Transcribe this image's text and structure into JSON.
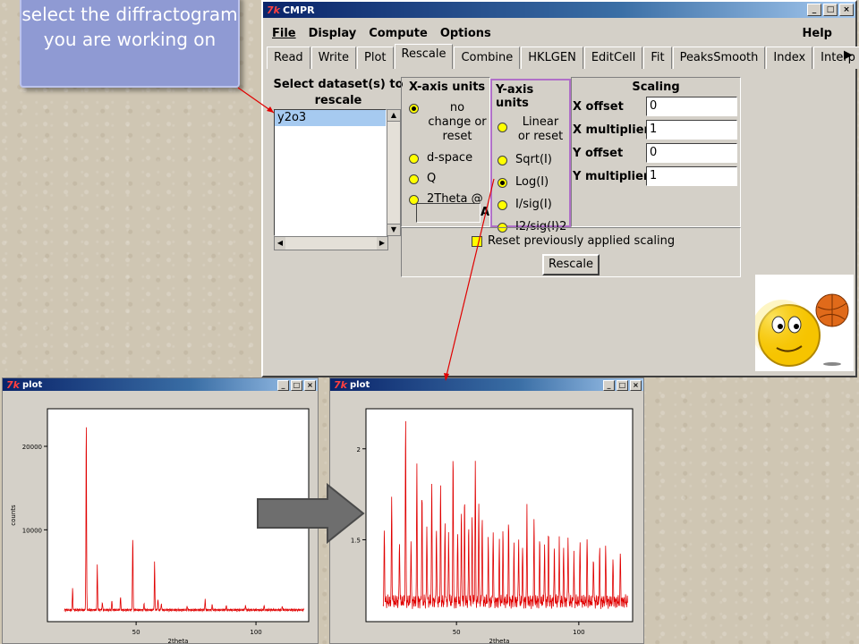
{
  "callout": {
    "text": "select the diffractogram you are working on"
  },
  "cmpr": {
    "title": "CMPR",
    "title_logo": "7k",
    "window_buttons": [
      "_",
      "□",
      "×"
    ],
    "menu": [
      "File",
      "Display",
      "Compute",
      "Options"
    ],
    "help": "Help",
    "tabs": [
      "Read",
      "Write",
      "Plot",
      "Rescale",
      "Combine",
      "HKLGEN",
      "EditCell",
      "Fit",
      "PeaksSmooth",
      "Index",
      "Interp"
    ],
    "active_tab": "Rescale",
    "dataset": {
      "header": "Select dataset(s) to rescale",
      "items": [
        "y2o3"
      ],
      "selected": "y2o3"
    },
    "xaxis": {
      "header": "X-axis units",
      "options": [
        "no change or reset",
        "d-space",
        "Q",
        "2Theta @"
      ],
      "selected": "no change or reset",
      "wavelength_value": "",
      "wavelength_unit": "A"
    },
    "yaxis": {
      "header": "Y-axis units",
      "options": [
        "Linear or reset",
        "Sqrt(I)",
        "Log(I)",
        "I/sig(I)",
        "I2/sig(I)2"
      ],
      "selected": "Log(I)"
    },
    "scaling": {
      "header": "Scaling",
      "rows": [
        {
          "label": "X offset",
          "value": "0"
        },
        {
          "label": "X multiplier",
          "value": "1"
        },
        {
          "label": "Y offset",
          "value": "0"
        },
        {
          "label": "Y multiplier",
          "value": "1"
        }
      ]
    },
    "reset_checkbox": {
      "label": "Reset previously applied scaling",
      "checked": false
    },
    "rescale_button": "Rescale"
  },
  "plot_left": {
    "title": "plot",
    "chart_data": {
      "type": "line",
      "xlabel": "2theta",
      "ylabel": "counts",
      "xlim": [
        13,
        122
      ],
      "ylim": [
        -1000,
        24500
      ],
      "xticks": [
        50,
        100
      ],
      "yticks": [
        10000,
        20000
      ],
      "series_color": "#e00000",
      "baseline": 400,
      "peaks": [
        {
          "x": 23.5,
          "y": 3000
        },
        {
          "x": 29.2,
          "y": 23300
        },
        {
          "x": 33.8,
          "y": 5700
        },
        {
          "x": 35.9,
          "y": 1300
        },
        {
          "x": 39.9,
          "y": 1500
        },
        {
          "x": 43.5,
          "y": 1900
        },
        {
          "x": 48.6,
          "y": 9300
        },
        {
          "x": 53.3,
          "y": 1100
        },
        {
          "x": 57.7,
          "y": 6200
        },
        {
          "x": 59.1,
          "y": 1700
        },
        {
          "x": 60.5,
          "y": 1200
        },
        {
          "x": 71.3,
          "y": 800
        },
        {
          "x": 78.8,
          "y": 1600
        },
        {
          "x": 81.7,
          "y": 1000
        },
        {
          "x": 87.6,
          "y": 900
        },
        {
          "x": 95.6,
          "y": 1000
        },
        {
          "x": 103.4,
          "y": 900
        },
        {
          "x": 111.0,
          "y": 800
        }
      ]
    }
  },
  "plot_right": {
    "title": "plot",
    "chart_data": {
      "type": "line",
      "xlabel": "2theta",
      "ylabel": "",
      "xlim": [
        13,
        122
      ],
      "ylim": [
        1.05,
        2.22
      ],
      "xticks": [
        50,
        100
      ],
      "yticks": [
        1.5,
        2
      ],
      "series_color": "#e00000",
      "baseline": 1.16,
      "peaks": [
        {
          "x": 20.5,
          "y": 1.55
        },
        {
          "x": 23.5,
          "y": 1.73
        },
        {
          "x": 26.7,
          "y": 1.52
        },
        {
          "x": 29.2,
          "y": 2.18
        },
        {
          "x": 31.4,
          "y": 1.5
        },
        {
          "x": 33.8,
          "y": 1.88
        },
        {
          "x": 35.9,
          "y": 1.78
        },
        {
          "x": 37.9,
          "y": 1.6
        },
        {
          "x": 39.9,
          "y": 1.82
        },
        {
          "x": 41.8,
          "y": 1.58
        },
        {
          "x": 43.5,
          "y": 1.8
        },
        {
          "x": 45.3,
          "y": 1.6
        },
        {
          "x": 46.8,
          "y": 1.55
        },
        {
          "x": 48.6,
          "y": 2.0
        },
        {
          "x": 50.5,
          "y": 1.55
        },
        {
          "x": 52.0,
          "y": 1.66
        },
        {
          "x": 53.3,
          "y": 1.72
        },
        {
          "x": 55.0,
          "y": 1.58
        },
        {
          "x": 56.4,
          "y": 1.62
        },
        {
          "x": 57.7,
          "y": 1.92
        },
        {
          "x": 59.1,
          "y": 1.72
        },
        {
          "x": 60.5,
          "y": 1.65
        },
        {
          "x": 63.0,
          "y": 1.5
        },
        {
          "x": 65.0,
          "y": 1.56
        },
        {
          "x": 67.5,
          "y": 1.47
        },
        {
          "x": 69.0,
          "y": 1.55
        },
        {
          "x": 71.3,
          "y": 1.6
        },
        {
          "x": 73.5,
          "y": 1.45
        },
        {
          "x": 75.4,
          "y": 1.52
        },
        {
          "x": 77.0,
          "y": 1.48
        },
        {
          "x": 78.8,
          "y": 1.66
        },
        {
          "x": 81.7,
          "y": 1.6
        },
        {
          "x": 84.0,
          "y": 1.5
        },
        {
          "x": 86.0,
          "y": 1.47
        },
        {
          "x": 87.6,
          "y": 1.55
        },
        {
          "x": 90.0,
          "y": 1.44
        },
        {
          "x": 92.0,
          "y": 1.5
        },
        {
          "x": 93.8,
          "y": 1.46
        },
        {
          "x": 95.6,
          "y": 1.52
        },
        {
          "x": 98.0,
          "y": 1.42
        },
        {
          "x": 100.5,
          "y": 1.48
        },
        {
          "x": 103.4,
          "y": 1.5
        },
        {
          "x": 106.0,
          "y": 1.42
        },
        {
          "x": 108.5,
          "y": 1.45
        },
        {
          "x": 111.0,
          "y": 1.47
        },
        {
          "x": 114.0,
          "y": 1.4
        },
        {
          "x": 117.0,
          "y": 1.44
        }
      ]
    }
  }
}
